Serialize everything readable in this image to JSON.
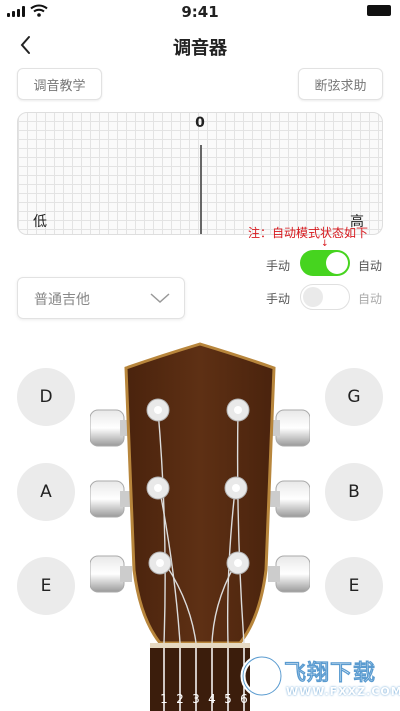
{
  "status_bar": {
    "time": "9:41"
  },
  "header": {
    "title": "调音器"
  },
  "toolbar": {
    "tutorial_label": "调音教学",
    "help_label": "断弦求助"
  },
  "meter": {
    "center_label": "0",
    "low_label": "低",
    "high_label": "高"
  },
  "annotation": {
    "text": "注：自动模式状态如下",
    "arrow": "↓"
  },
  "mode_toggles": [
    {
      "left_label": "手动",
      "right_label": "自动",
      "state": "on"
    },
    {
      "left_label": "手动",
      "right_label": "自动",
      "state": "off"
    }
  ],
  "instrument_select": {
    "value": "普通吉他"
  },
  "strings": {
    "left": [
      "D",
      "A",
      "E"
    ],
    "right": [
      "G",
      "B",
      "E"
    ]
  },
  "fret_numbers": [
    "1",
    "2",
    "3",
    "4",
    "5",
    "6"
  ],
  "watermark": {
    "text": "飞翔下载",
    "url": "WWW.FXXZ.COM"
  },
  "colors": {
    "toggle_on": "#46d41f",
    "annotation": "#d7191e",
    "headstock": "#5b2e12"
  },
  "icons": [
    "signal-icon",
    "wifi-icon",
    "battery-icon",
    "back-chevron-icon",
    "chevron-down-icon"
  ]
}
